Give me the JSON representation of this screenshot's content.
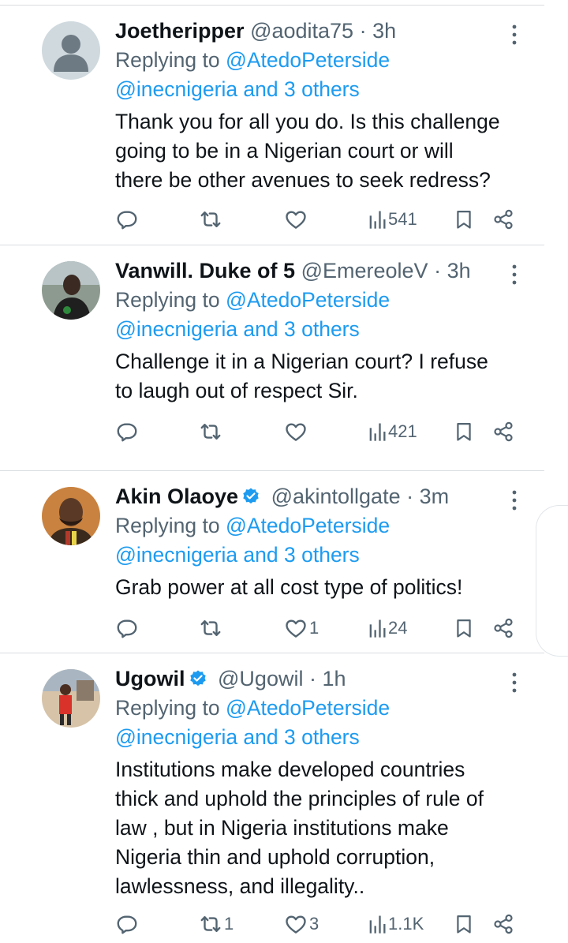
{
  "tweets": [
    {
      "display_name": "Joetheripper",
      "handle": "@aodita75",
      "separator": "·",
      "time": "3h",
      "verified": false,
      "avatar": "default-avatar-icon",
      "replying_prefix": "Replying to",
      "replying_to": "@AtedoPeterside",
      "replying_others": "@inecnigeria and 3 others",
      "text_lines": [
        "Thank you for all you do. Is this challenge",
        "going to be in a Nigerian court or will",
        "there be other avenues to seek redress?"
      ],
      "replies": "",
      "retweets": "",
      "likes": "",
      "views": "541"
    },
    {
      "display_name": "Vanwill. Duke of 5",
      "handle": "@EmereoleV",
      "separator": "·",
      "time": "3h",
      "verified": false,
      "avatar": "user-photo",
      "replying_prefix": "Replying to",
      "replying_to": "@AtedoPeterside",
      "replying_others": "@inecnigeria and 3 others",
      "text_lines": [
        "Challenge it in a Nigerian court? I refuse",
        "to laugh out of respect Sir."
      ],
      "replies": "",
      "retweets": "",
      "likes": "",
      "views": "421"
    },
    {
      "display_name": "Akin Olaoye",
      "handle": "@akintollgate",
      "separator": "·",
      "time": "3m",
      "verified": true,
      "avatar": "user-photo",
      "replying_prefix": "Replying to",
      "replying_to": "@AtedoPeterside",
      "replying_others": "@inecnigeria and 3 others",
      "text_lines": [
        "Grab power at all cost type of politics!"
      ],
      "replies": "",
      "retweets": "",
      "likes": "1",
      "views": "24"
    },
    {
      "display_name": "Ugowil",
      "handle": "@Ugowil",
      "separator": "·",
      "time": "1h",
      "verified": true,
      "avatar": "user-photo",
      "replying_prefix": "Replying to",
      "replying_to": "@AtedoPeterside",
      "replying_others": "@inecnigeria and 3 others",
      "text_lines": [
        "Institutions make developed countries",
        "thick and uphold the principles of rule of",
        "law , but in Nigeria institutions make",
        "Nigeria thin and uphold corruption,",
        "lawlessness, and illegality.."
      ],
      "replies": "",
      "retweets": "1",
      "likes": "3",
      "views": "1.1K"
    }
  ],
  "icons": {
    "reply": "reply-icon",
    "retweet": "retweet-icon",
    "like": "heart-icon",
    "views": "views-icon",
    "bookmark": "bookmark-icon",
    "share": "share-icon",
    "more": "more-icon",
    "verified": "verified-badge-icon"
  },
  "colors": {
    "text": "#0f1419",
    "secondary": "#536471",
    "link": "#1d9bf0",
    "verified": "#1d9bf0",
    "divider": "#d9dde0"
  }
}
